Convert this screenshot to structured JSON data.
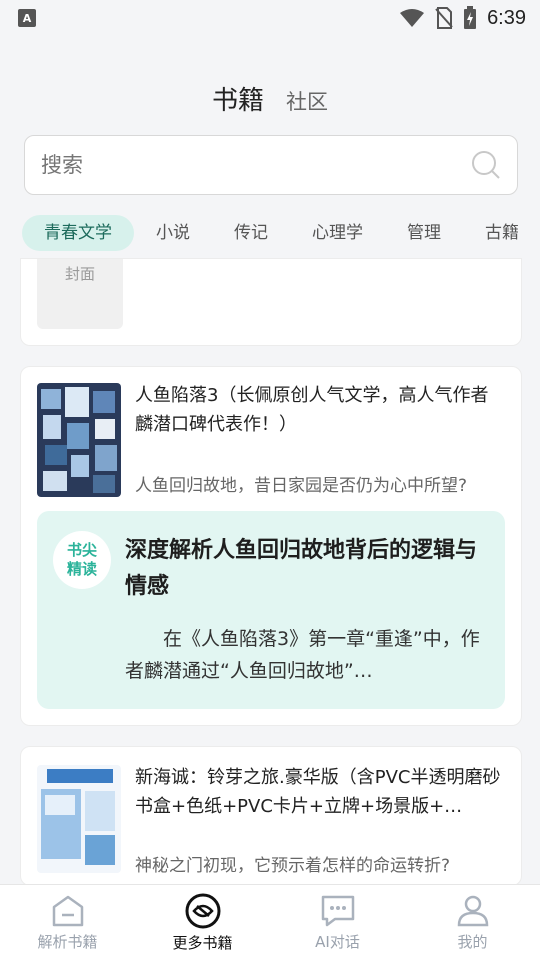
{
  "status_bar": {
    "time": "6:39",
    "left_badge": "A"
  },
  "header": {
    "tab_books": "书籍",
    "tab_community": "社区"
  },
  "search": {
    "placeholder": "搜索"
  },
  "categories": [
    "青春文学",
    "小说",
    "传记",
    "心理学",
    "管理",
    "古籍"
  ],
  "card1": {
    "placeholder_label": "封面"
  },
  "book1": {
    "title": "人鱼陷落3（长佩原创人气文学，高人气作者麟潜口碑代表作！）",
    "tagline": "人鱼回归故地，昔日家园是否仍为心中所望?",
    "insight_badge_line1": "书尖",
    "insight_badge_line2": "精读",
    "insight_title": "深度解析人鱼回归故地背后的逻辑与情感",
    "insight_body": "在《人鱼陷落3》第一章“重逢”中，作者麟潜通过“人鱼回归故地”…"
  },
  "book2": {
    "title": "新海诚：铃芽之旅.豪华版（含PVC半透明磨砂书盒+色纸+PVC卡片+立牌+场景版+…",
    "tagline": "神秘之门初现，它预示着怎样的命运转折?"
  },
  "bottom_nav": [
    {
      "label": "解析书籍",
      "icon": "home-icon"
    },
    {
      "label": "更多书籍",
      "icon": "books-icon"
    },
    {
      "label": "AI对话",
      "icon": "chat-icon"
    },
    {
      "label": "我的",
      "icon": "profile-icon"
    }
  ],
  "colors": {
    "accent": "#2bb39a",
    "active_chip": "#d7f1ec",
    "insight_bg": "#e2f6f2"
  }
}
